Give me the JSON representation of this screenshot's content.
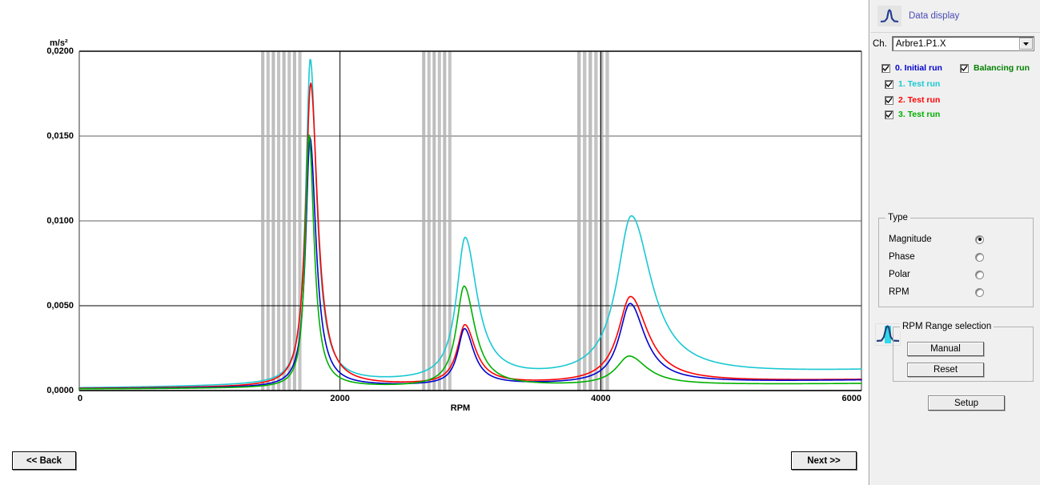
{
  "window": {
    "title": "Data display"
  },
  "panel": {
    "header": {
      "icon": "resonance-peak-icon",
      "title": "Data display"
    },
    "channel": {
      "label": "Ch.",
      "value": "Arbre1.P1.X",
      "arrow_icon": "chevron-down-icon"
    },
    "legend": [
      {
        "label": "0.  Initial run",
        "color": "#0000cd",
        "checked": true
      },
      {
        "label": "Balancing run",
        "color": "#008000",
        "checked": true
      },
      {
        "label": "1. Test run",
        "color": "#19c8d2",
        "checked": true
      },
      {
        "label": "2. Test run",
        "color": "#ff0000",
        "checked": true
      },
      {
        "label": "3. Test run",
        "color": "#00b000",
        "checked": true
      }
    ],
    "type": {
      "title": "Type",
      "options": [
        {
          "label": "Magnitude",
          "selected": true
        },
        {
          "label": "Phase",
          "selected": false
        },
        {
          "label": "Polar",
          "selected": false
        },
        {
          "label": "RPM",
          "selected": false
        }
      ]
    },
    "rpm_range": {
      "title": "RPM Range selection",
      "icon": "rpm-range-peak-icon",
      "manual_label": "Manual",
      "reset_label": "Reset"
    },
    "setup_label": "Setup"
  },
  "nav": {
    "back_label": "<< Back",
    "next_label": "Next >>"
  },
  "chart_data": {
    "type": "line",
    "title": "",
    "xlabel": "RPM",
    "ylabel": "m/s²",
    "yunit": "m/s²",
    "xlim": [
      0,
      6000
    ],
    "ylim": [
      0,
      0.02
    ],
    "grid": true,
    "xticks": [
      "0",
      "2000",
      "4000",
      "6000"
    ],
    "xtick_values": [
      0,
      2000,
      4000,
      6000
    ],
    "yticks": [
      "0,0000",
      "0,0050",
      "0,0100",
      "0,0150",
      "0,0200"
    ],
    "ytick_values": [
      0.0,
      0.005,
      0.01,
      0.015,
      0.02
    ],
    "legend_position": "external-right-panel",
    "resonances": [
      1770,
      2960,
      4230
    ],
    "rpm_range_bands": [
      {
        "start": 1395,
        "end": 1720
      },
      {
        "start": 2630,
        "end": 2870
      },
      {
        "start": 3820,
        "end": 4080
      }
    ],
    "series": [
      {
        "name": "1. Test run",
        "color": "#19c8d2",
        "peaks": [
          {
            "rpm": 1772,
            "value": 0.0193
          },
          {
            "rpm": 2960,
            "value": 0.0085
          },
          {
            "rpm": 4235,
            "value": 0.0096
          }
        ],
        "baseline_start": 0.00015,
        "baseline_end": 0.00115,
        "widths": [
          42,
          80,
          135
        ]
      },
      {
        "name": "2. Test run",
        "color": "#ff0000",
        "peaks": [
          {
            "rpm": 1775,
            "value": 0.018
          },
          {
            "rpm": 2958,
            "value": 0.0036
          },
          {
            "rpm": 4228,
            "value": 0.0052
          }
        ],
        "baseline_start": 0.00012,
        "baseline_end": 0.00062,
        "widths": [
          46,
          70,
          115
        ]
      },
      {
        "name": "0.  Initial run",
        "color": "#0000cd",
        "peaks": [
          {
            "rpm": 1770,
            "value": 0.0148
          },
          {
            "rpm": 2955,
            "value": 0.0034
          },
          {
            "rpm": 4225,
            "value": 0.0048
          }
        ],
        "baseline_start": 0.0001,
        "baseline_end": 0.0006,
        "widths": [
          40,
          62,
          100
        ]
      },
      {
        "name": "3. Test run",
        "color": "#00b000",
        "peaks": [
          {
            "rpm": 1762,
            "value": 0.015
          },
          {
            "rpm": 2952,
            "value": 0.006
          },
          {
            "rpm": 4218,
            "value": 0.0018
          }
        ],
        "baseline_start": 9e-05,
        "baseline_end": 0.0004,
        "widths": [
          34,
          72,
          120
        ]
      }
    ]
  }
}
